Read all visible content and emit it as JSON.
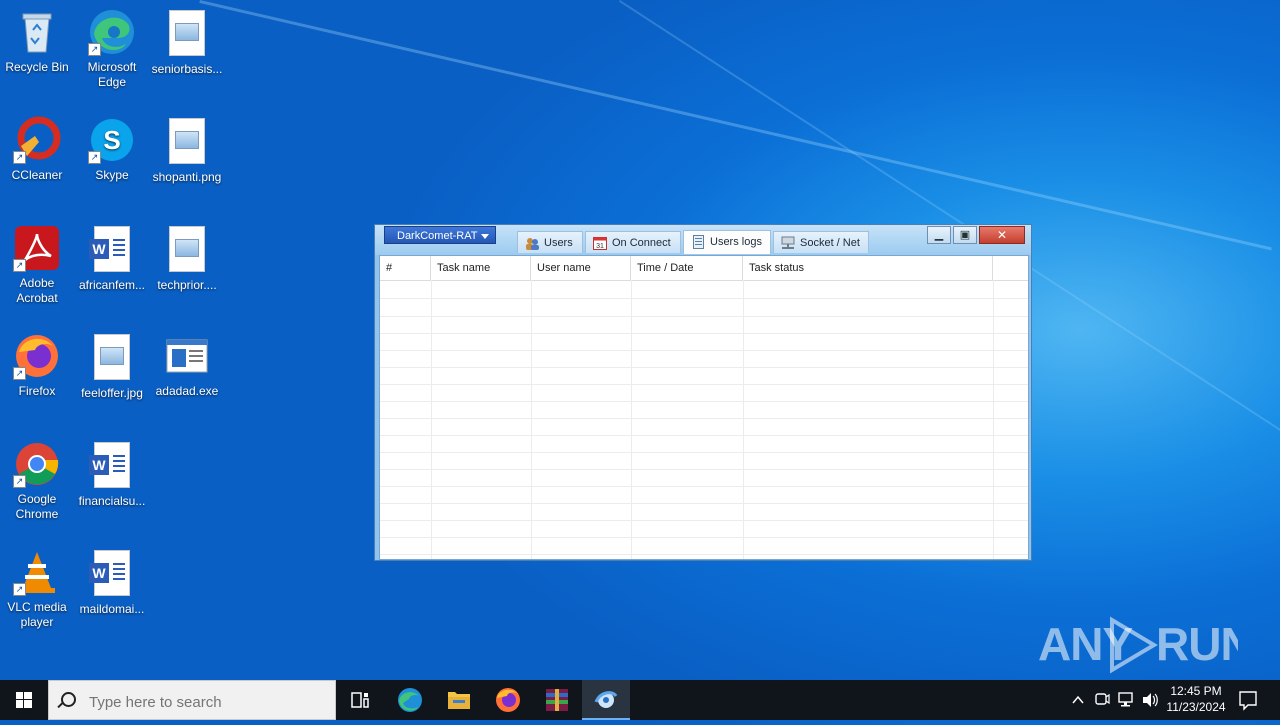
{
  "desktop": {
    "icons": [
      {
        "label": "Recycle Bin"
      },
      {
        "label": "Microsoft Edge"
      },
      {
        "label": "seniorbasis..."
      },
      {
        "label": "CCleaner"
      },
      {
        "label": "Skype"
      },
      {
        "label": "shopanti.png"
      },
      {
        "label": "Adobe Acrobat"
      },
      {
        "label": "africanfem..."
      },
      {
        "label": "techprior...."
      },
      {
        "label": "Firefox"
      },
      {
        "label": "feeloffer.jpg"
      },
      {
        "label": "adadad.exe"
      },
      {
        "label": "Google Chrome"
      },
      {
        "label": "financialsu..."
      },
      {
        "label": "VLC media player"
      },
      {
        "label": "maildomai..."
      }
    ]
  },
  "window": {
    "menu_label": "DarkComet-RAT",
    "tabs": [
      {
        "label": "Users",
        "icon": "users-icon"
      },
      {
        "label": "On Connect",
        "icon": "calendar-icon"
      },
      {
        "label": "Users logs",
        "icon": "log-icon",
        "active": true
      },
      {
        "label": "Socket / Net",
        "icon": "network-icon"
      }
    ],
    "columns": [
      "#",
      "Task name",
      "User name",
      "Time / Date",
      "Task status"
    ]
  },
  "watermark": "ANY RUN",
  "taskbar": {
    "search_placeholder": "Type here to search",
    "time": "12:45 PM",
    "date": "11/23/2024"
  }
}
